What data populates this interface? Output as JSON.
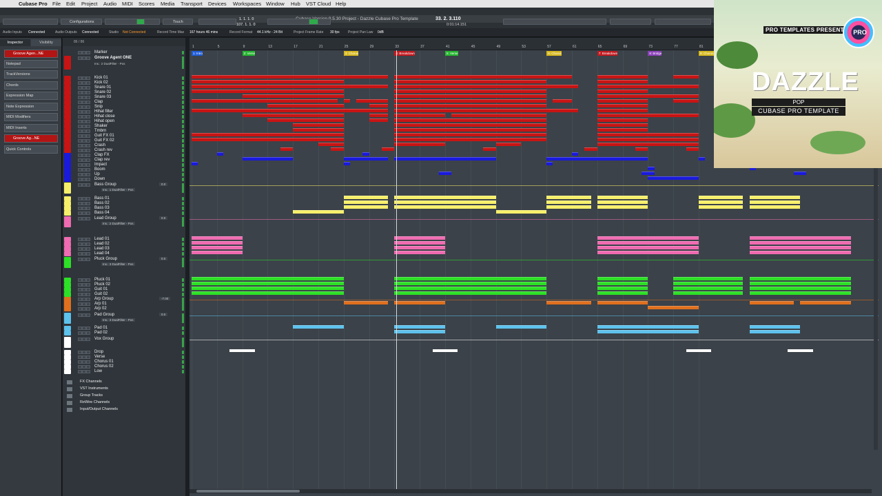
{
  "menubar": {
    "app": "Cubase Pro",
    "items": [
      "File",
      "Edit",
      "Project",
      "Audio",
      "MIDI",
      "Scores",
      "Media",
      "Transport",
      "Devices",
      "Workspaces",
      "Window",
      "Hub",
      "VST Cloud",
      "Help"
    ]
  },
  "window": {
    "title": "Cubase Version 9.5.30 Project - Dazzle Cubase Pro Template"
  },
  "toolbar": {
    "configurations": "Configurations",
    "mode": "Touch",
    "position_bars": "33. 2. 3.110",
    "position_time": "0:01:14.151",
    "locator_top": "1. 1. 1.  0",
    "locator_bottom": "107. 1. 1.  0"
  },
  "status": {
    "audio_inputs": "Audio Inputs",
    "audio_inputs_val": "Connected",
    "audio_outputs": "Audio Outputs",
    "audio_outputs_val": "Connected",
    "studio": "Studio",
    "studio_val": "Not Connected",
    "record_time": "Record Time Max",
    "record_time_val": "167 hours 46 mins",
    "record_format": "Record Format",
    "record_format_val": "44.1 kHz - 24 Bit",
    "frame_rate": "Project Frame Rate",
    "frame_rate_val": "30 fps",
    "pan_law": "Project Pan Law",
    "pan_law_val": "0dB"
  },
  "inspector": {
    "tab_inspector": "Inspector",
    "tab_visibility": "Visibility",
    "track": "Groove Agen...NE",
    "items": [
      "Notepad",
      "TrackVersions",
      "Chords",
      "Expression Map",
      "Note Expression",
      "MIDI Modifiers",
      "MIDI Inserts"
    ],
    "track2": "Groove Ag...NE",
    "quick_controls": "Quick Controls"
  },
  "tracklist": {
    "count": "86 / 86",
    "marker": "Marker",
    "groove": "Groove Agent ONE",
    "groove_insert": "Ins.: 2 DualFilter - Pos"
  },
  "drums": [
    "Kick 01",
    "Kick 02",
    "Snare 01",
    "Snare 02",
    "Snare 03",
    "Clap",
    "Snip",
    "Hihat filter",
    "Hihat close",
    "Hihat open",
    "Shaker",
    "Tmbrn",
    "Guit FX 01",
    "Guit FX 02",
    "Crash",
    "Crash rev",
    "Clap FX",
    "Clap rev",
    "Impact",
    "Boom",
    "Up",
    "Down"
  ],
  "groups": [
    {
      "name": "Bass Group",
      "insert": "Ins.: 1 DualFilter - Pos",
      "vol": "0.0",
      "tracks": [
        "Bass 01",
        "Bass 02",
        "Bass 03",
        "Bass 04"
      ]
    },
    {
      "name": "Lead Group",
      "insert": "Ins.: 2 DualFilter - Pos",
      "vol": "0.0",
      "tracks": [
        "Lead 01",
        "Lead 02",
        "Lead 03",
        "Lead 04"
      ]
    },
    {
      "name": "Pluck Group",
      "insert": "Ins.: 3 DualFilter - Pos",
      "vol": "0.0",
      "tracks": [
        "Pluck 01",
        "Pluck 02",
        "Guit 01",
        "Guit 02"
      ]
    },
    {
      "name": "Arp Group",
      "vol": "-7.00",
      "tracks": [
        "Arp 01",
        "Arp 02"
      ]
    },
    {
      "name": "Pad Group",
      "insert": "Ins.: 3 DualFilter - Pos",
      "vol": "0.0",
      "tracks": [
        "Pad 01",
        "Pad 02"
      ]
    },
    {
      "name": "Vox Group",
      "tracks": [
        "Drop",
        "Verse",
        "Chorus 01",
        "Chorus 02",
        "Low"
      ]
    }
  ],
  "folders": [
    "FX Channels",
    "VST Instruments",
    "Group Tracks",
    "ReWire Channels",
    "Input/Output Channels"
  ],
  "ruler": [
    "1",
    "5",
    "9",
    "13",
    "17",
    "21",
    "25",
    "29",
    "33",
    "37",
    "41",
    "45",
    "49",
    "53",
    "57",
    "61",
    "65",
    "69",
    "73",
    "77",
    "81"
  ],
  "markers": [
    {
      "label": "1: Intro",
      "bar": 1,
      "color": "#1e5bd6"
    },
    {
      "label": "2: Verse",
      "bar": 9,
      "color": "#25b52f"
    },
    {
      "label": "3: Chorus",
      "bar": 25,
      "color": "#d6b81e"
    },
    {
      "label": "4: Breakdown",
      "bar": 33,
      "color": "#c0181e"
    },
    {
      "label": "5: Verse",
      "bar": 41,
      "color": "#25b52f"
    },
    {
      "label": "6: Chorus",
      "bar": 57,
      "color": "#d6b81e"
    },
    {
      "label": "7: Breakdown",
      "bar": 65,
      "color": "#c0181e"
    },
    {
      "label": "8: Bridge",
      "bar": 73,
      "color": "#8a3fb8"
    },
    {
      "label": "9: Chorus",
      "bar": 81,
      "color": "#d6b81e"
    }
  ],
  "colors": {
    "drums": "#c81414",
    "fx": "#1a1adc",
    "bass": "#f7ef6a",
    "lead": "#f06bb1",
    "pluck": "#2de026",
    "arp": "#e0701e",
    "pad": "#5dc2ec",
    "vox": "#ffffff"
  },
  "promo": {
    "presents": "PRO TEMPLATES PRESENTS",
    "logo": "PRO",
    "title": "DAZZLE",
    "genre": "POP",
    "subtitle": "CUBASE PRO TEMPLATE"
  }
}
